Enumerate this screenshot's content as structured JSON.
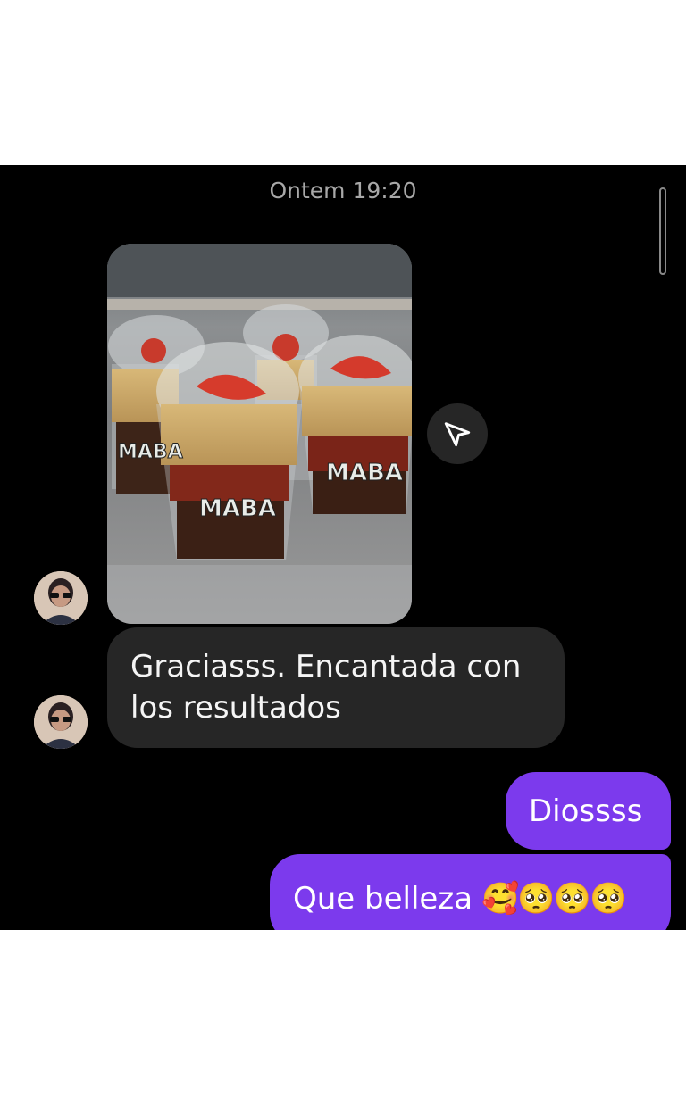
{
  "chat": {
    "timestamp": "Ontem 19:20",
    "photo": {
      "cup_label": "MABA",
      "icon": "share-icon"
    },
    "incoming_message": "Graciasss. Encantada con los resultados",
    "outgoing_messages": [
      {
        "text": "Diossss"
      },
      {
        "text": "Que belleza",
        "emojis": "🥰🥺🥺🥺"
      }
    ]
  },
  "colors": {
    "background": "#000000",
    "incoming_bubble": "#262626",
    "outgoing_bubble": "#7c3aed",
    "timestamp_text": "#a8a8a8"
  }
}
